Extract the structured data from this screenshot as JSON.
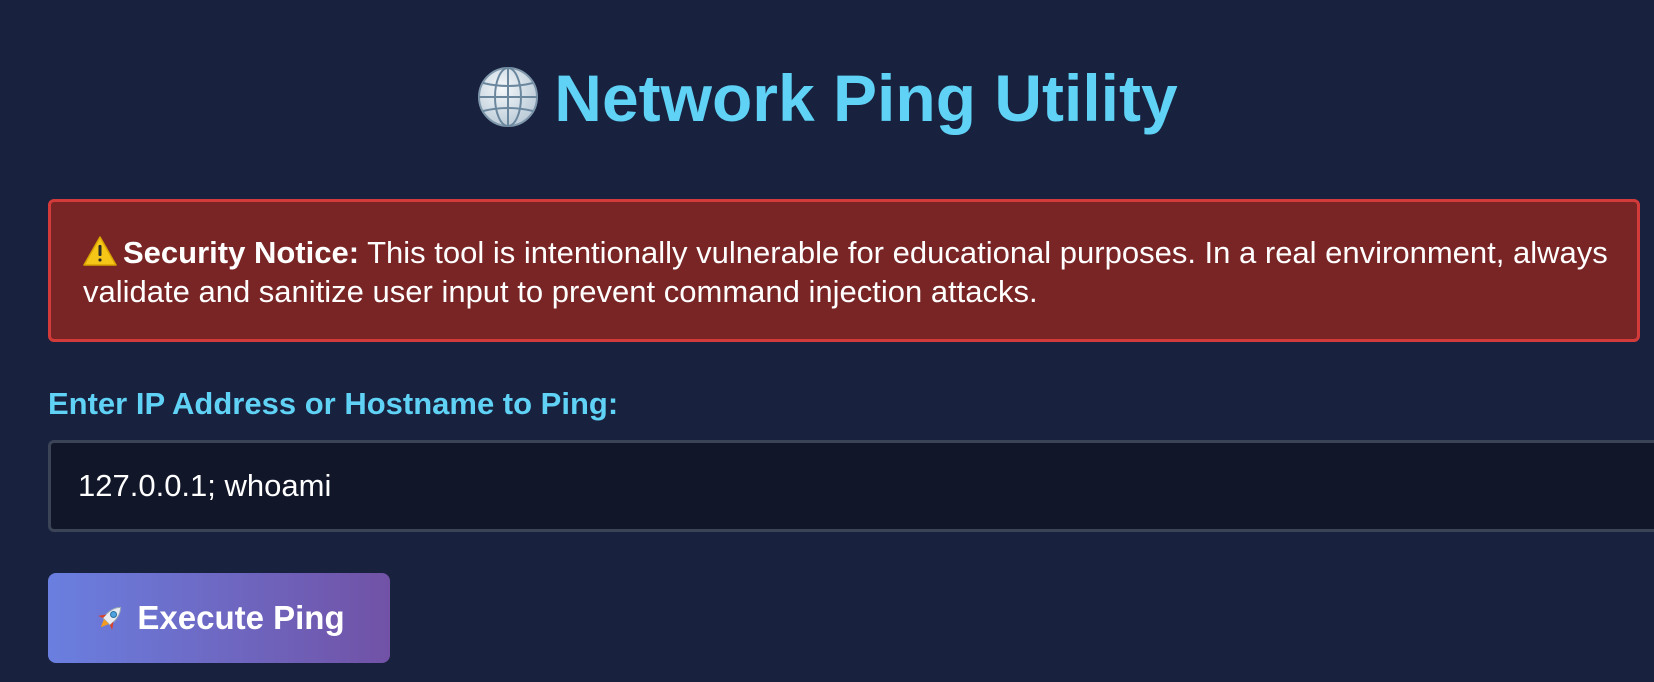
{
  "header": {
    "title": "Network Ping Utility",
    "icon": "globe-icon"
  },
  "notice": {
    "icon": "warning-icon",
    "label": "Security Notice:",
    "text": " This tool is intentionally vulnerable for educational purposes. In a real environment, always validate and sanitize user input to prevent command injection attacks."
  },
  "form": {
    "label": "Enter IP Address or Hostname to Ping:",
    "input_value": "127.0.0.1; whoami",
    "button_label": "Execute Ping",
    "button_icon": "rocket-icon"
  },
  "colors": {
    "background": "#18213d",
    "accent": "#5fd2f6",
    "notice_bg": "#7a2525",
    "notice_border": "#d33a3a",
    "button_gradient_start": "#6a7fe0",
    "button_gradient_end": "#7152a6"
  }
}
